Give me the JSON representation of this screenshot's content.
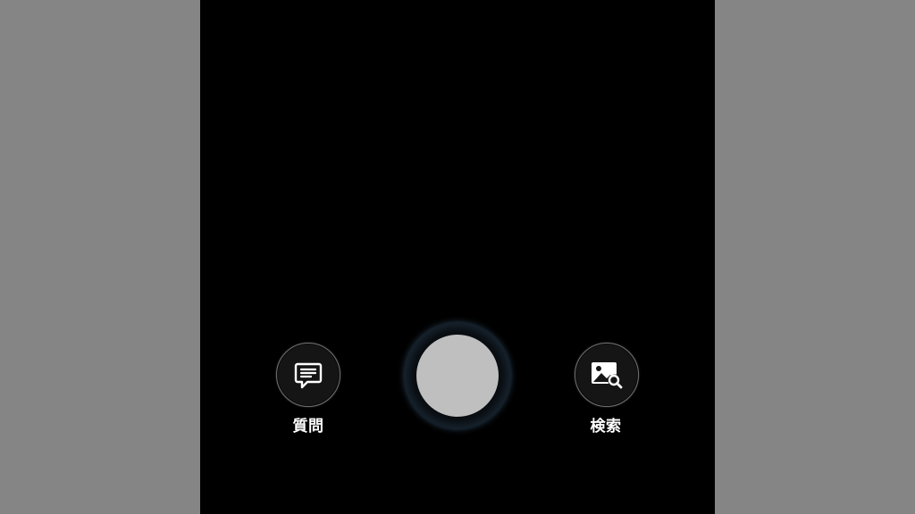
{
  "controls": {
    "ask": {
      "label": "質問",
      "icon": "chat-bubble-icon"
    },
    "shutter": {
      "icon": "shutter-button"
    },
    "search": {
      "label": "検索",
      "icon": "image-search-icon"
    }
  },
  "colors": {
    "background_side": "#858585",
    "viewfinder": "#000000",
    "shutter_fill": "#bfbfbf",
    "shutter_glow": "#5d7f9c"
  }
}
